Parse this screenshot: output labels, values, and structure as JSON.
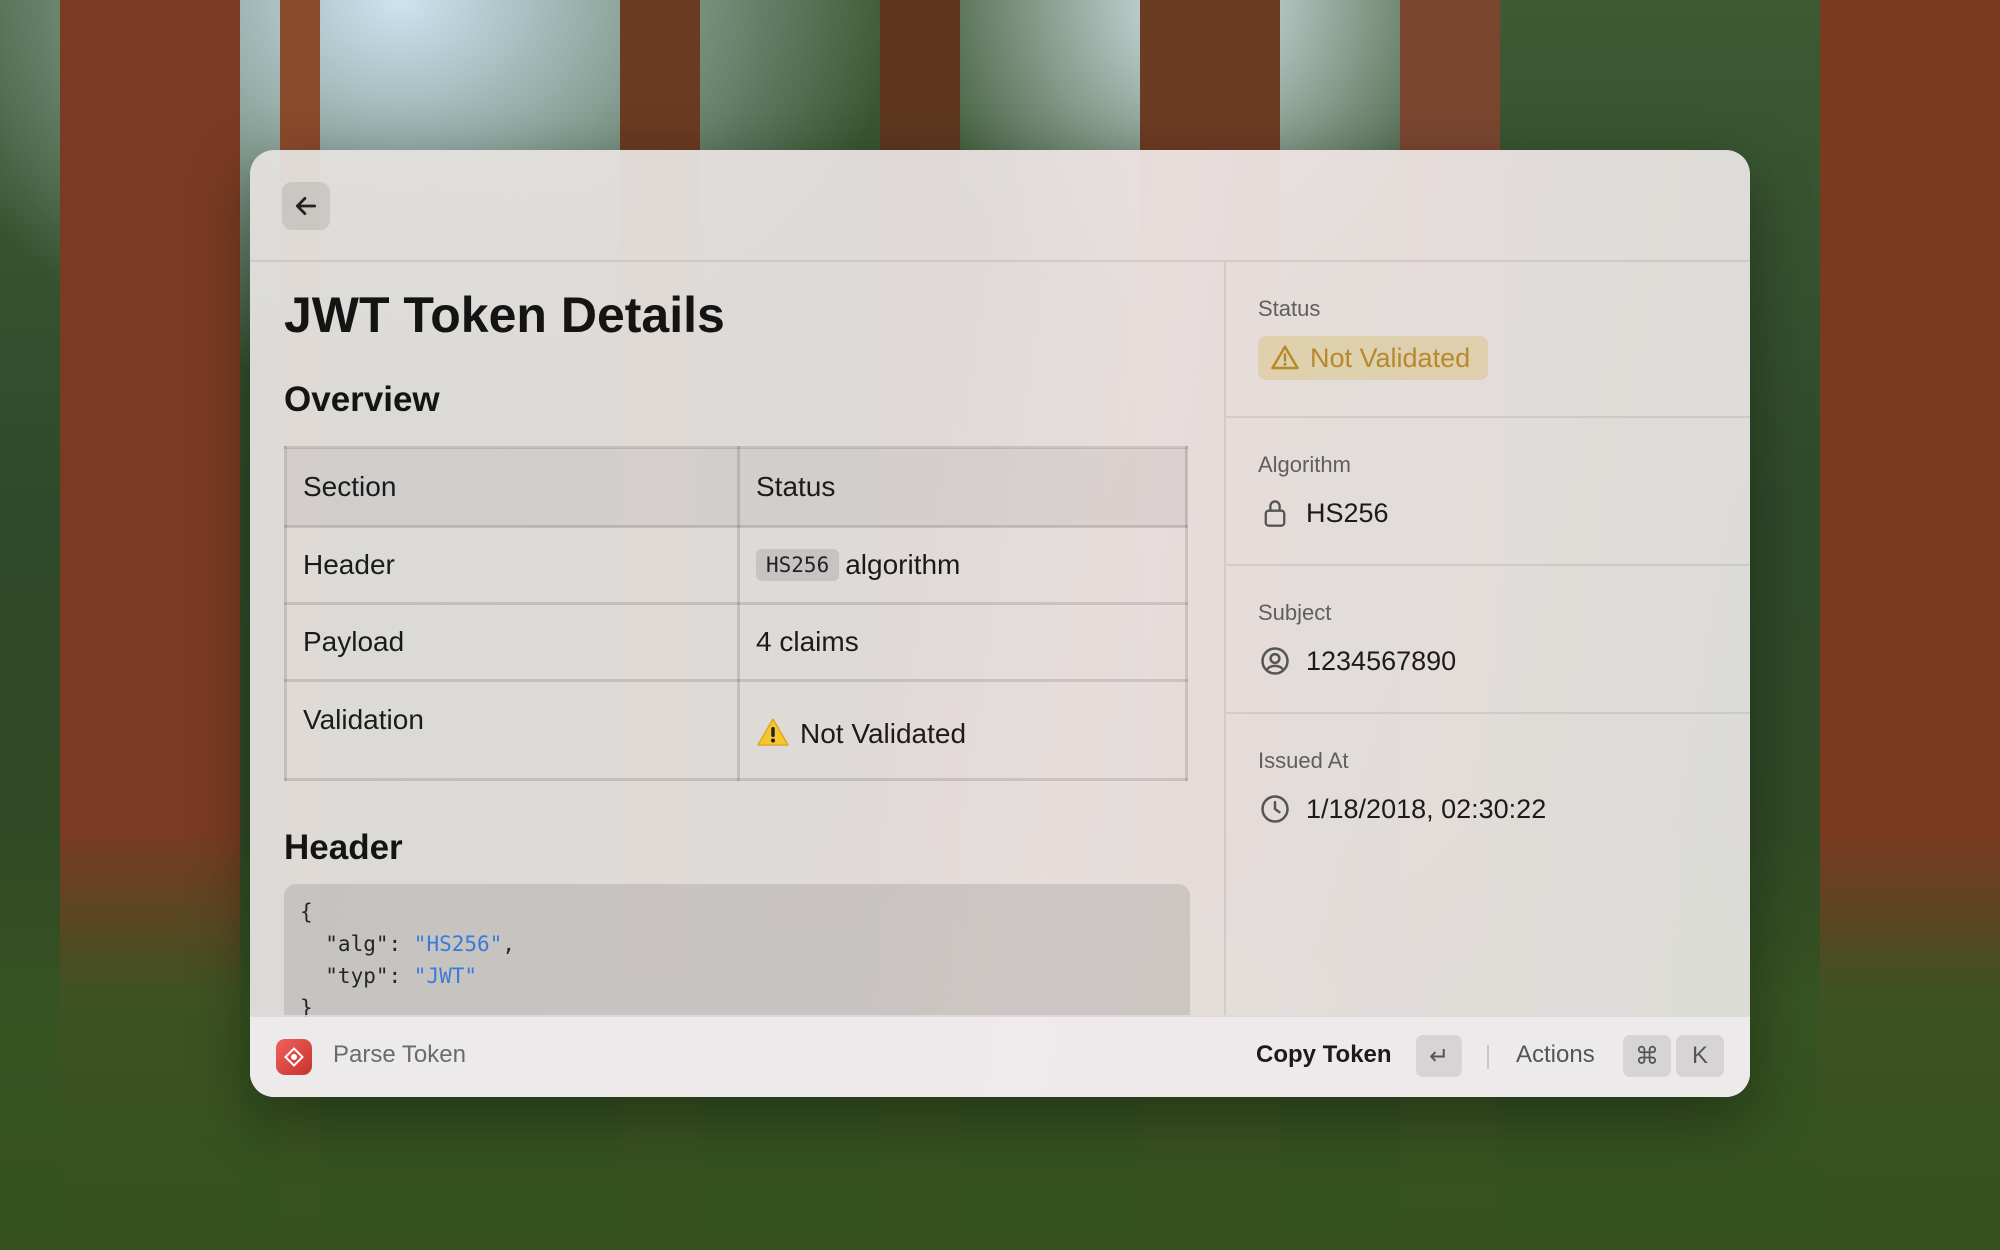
{
  "window": {
    "title": "JWT Token Details"
  },
  "overview": {
    "heading": "Overview",
    "columns": [
      "Section",
      "Status"
    ],
    "rows": [
      {
        "section": "Header",
        "tag": "HS256",
        "status": "algorithm"
      },
      {
        "section": "Payload",
        "status": "4 claims"
      },
      {
        "section": "Validation",
        "status": "Not Validated"
      }
    ]
  },
  "header_section": {
    "heading": "Header",
    "code": {
      "open": "{",
      "alg_key": "  \"alg\": ",
      "alg_val": "\"HS256\"",
      "alg_comma": ",",
      "typ_key": "  \"typ\": ",
      "typ_val": "\"JWT\"",
      "close": "}"
    }
  },
  "sidebar": {
    "status": {
      "label": "Status",
      "value": "Not Validated",
      "icon": "warning-icon",
      "color": "#b6892a"
    },
    "algorithm": {
      "label": "Algorithm",
      "value": "HS256",
      "icon": "lock-icon"
    },
    "subject": {
      "label": "Subject",
      "value": "1234567890",
      "icon": "user-circle-icon"
    },
    "issued_at": {
      "label": "Issued At",
      "value": "1/18/2018, 02:30:22",
      "icon": "clock-icon"
    }
  },
  "footer": {
    "command_title": "Parse Token",
    "primary_action": "Copy Token",
    "primary_key": "↵",
    "actions_label": "Actions",
    "actions_keys": [
      "⌘",
      "K"
    ]
  }
}
